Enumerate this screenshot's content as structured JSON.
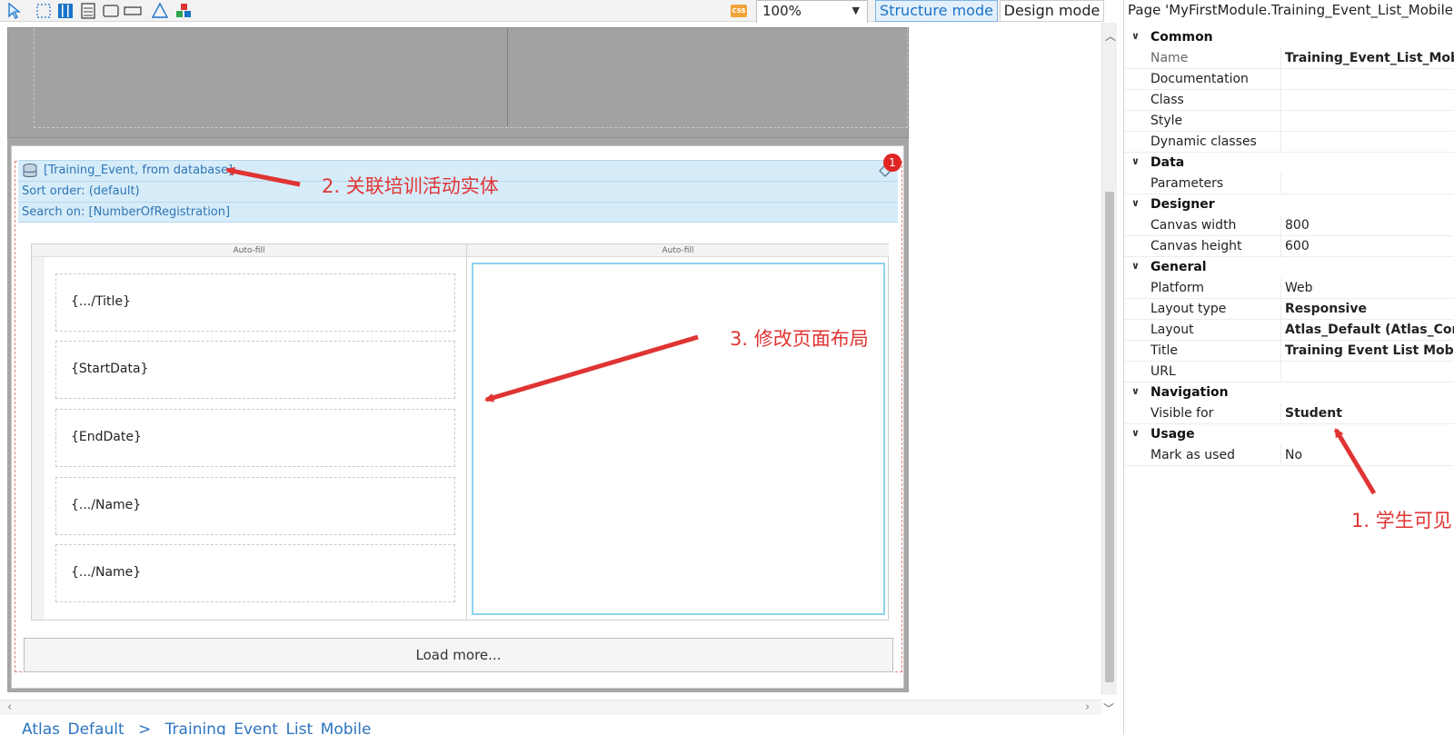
{
  "toolbar": {
    "tools": [
      "select-arrow-icon",
      "marquee-select-icon",
      "layout-columns-icon",
      "data-list-icon",
      "container-icon",
      "button-icon",
      "triangle-icon",
      "widgets-icon"
    ],
    "css_label": "CSS",
    "zoom_value": "100%",
    "structure_mode_label": "Structure mode",
    "design_mode_label": "Design mode"
  },
  "canvas": {
    "datasource": {
      "entity_label": "[Training_Event, from database]",
      "sort_order": "Sort order: (default)",
      "search_on": "Search on: [NumberOfRegistration]",
      "badge_count": "1"
    },
    "autofill_left": "Auto-fill",
    "autofill_right": "Auto-fill",
    "fields": [
      "{.../Title}",
      "{StartData}",
      "{EndDate}",
      "{.../Name}",
      "{.../Name}"
    ],
    "load_more_label": "Load more..."
  },
  "annotations": {
    "step1": "1. 学生可见",
    "step2": "2. 关联培训活动实体",
    "step3": "3. 修改页面布局",
    "color": "#e03434"
  },
  "breadcrumb": {
    "items": [
      "Atlas_Default",
      ">",
      "Training_Event_List_Mobile"
    ]
  },
  "properties": {
    "title": "Page 'MyFirstModule.Training_Event_List_Mobile'",
    "sections": {
      "common": "Common",
      "data": "Data",
      "designer": "Designer",
      "general": "General",
      "navigation": "Navigation",
      "usage": "Usage"
    },
    "rows": {
      "name": {
        "key": "Name",
        "value": "Training_Event_List_Mobile"
      },
      "documentation": {
        "key": "Documentation",
        "value": ""
      },
      "class": {
        "key": "Class",
        "value": ""
      },
      "style": {
        "key": "Style",
        "value": ""
      },
      "dynamic_classes": {
        "key": "Dynamic classes",
        "value": ""
      },
      "parameters": {
        "key": "Parameters",
        "value": ""
      },
      "canvas_width": {
        "key": "Canvas width",
        "value": "800"
      },
      "canvas_height": {
        "key": "Canvas height",
        "value": "600"
      },
      "platform": {
        "key": "Platform",
        "value": "Web"
      },
      "layout_type": {
        "key": "Layout type",
        "value": "Responsive"
      },
      "layout": {
        "key": "Layout",
        "value": "Atlas_Default (Atlas_Core)"
      },
      "title": {
        "key": "Title",
        "value": "Training Event List Mobile"
      },
      "url": {
        "key": "URL",
        "value": ""
      },
      "visible_for": {
        "key": "Visible for",
        "value": "Student"
      },
      "mark_as_used": {
        "key": "Mark as used",
        "value": "No"
      }
    }
  },
  "colors": {
    "accent_blue": "#1a73c9",
    "datasource_bg": "#d6ecf9",
    "container_border": "#8fd3ea"
  }
}
